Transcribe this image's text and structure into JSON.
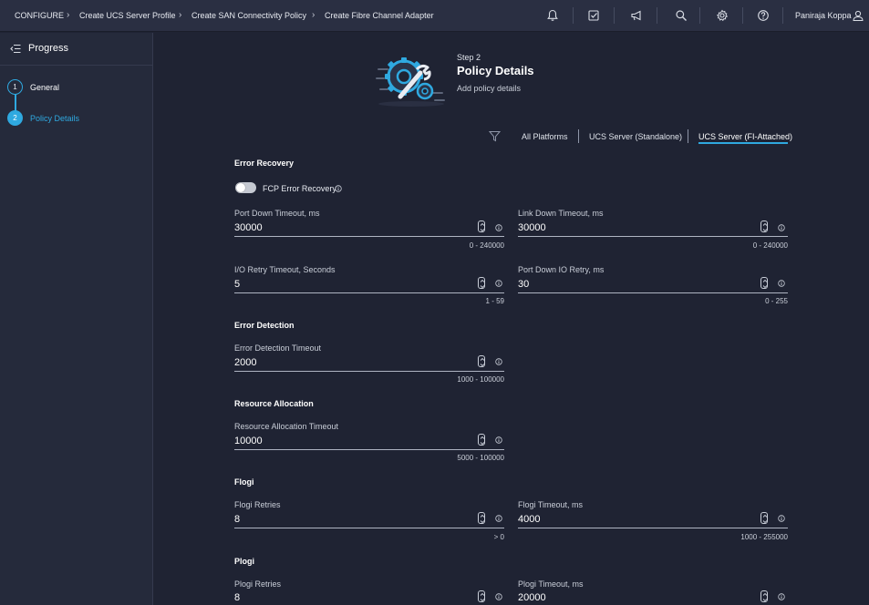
{
  "breadcrumb": {
    "items": [
      "CONFIGURE",
      "Create UCS Server Profile",
      "Create SAN Connectivity Policy",
      "Create Fibre Channel Adapter"
    ]
  },
  "topbar": {
    "icons": [
      "bell-icon",
      "tasks-icon",
      "megaphone-icon",
      "search-icon",
      "gear-icon",
      "help-icon"
    ],
    "user_name": "Paniraja Koppa"
  },
  "sidebar": {
    "title": "Progress",
    "steps": [
      {
        "number": "1",
        "label": "General",
        "active": false
      },
      {
        "number": "2",
        "label": "Policy Details",
        "active": true
      }
    ]
  },
  "header": {
    "step": "Step 2",
    "title": "Policy Details",
    "subtitle": "Add policy details"
  },
  "platform_tabs": {
    "items": [
      "All Platforms",
      "UCS Server (Standalone)",
      "UCS Server (FI-Attached)"
    ],
    "selected": "UCS Server (FI-Attached)"
  },
  "form": {
    "error_recovery": {
      "title": "Error Recovery",
      "fcp_toggle_label": "FCP Error Recovery",
      "fcp_toggle_on": false,
      "port_down_timeout": {
        "label": "Port Down Timeout, ms",
        "value": "30000",
        "range": "0 - 240000"
      },
      "link_down_timeout": {
        "label": "Link Down Timeout, ms",
        "value": "30000",
        "range": "0 - 240000"
      },
      "io_retry_timeout": {
        "label": "I/O Retry Timeout, Seconds",
        "value": "5",
        "range": "1 - 59"
      },
      "port_down_io_retry": {
        "label": "Port Down IO Retry, ms",
        "value": "30",
        "range": "0 - 255"
      }
    },
    "error_detection": {
      "title": "Error Detection",
      "timeout": {
        "label": "Error Detection Timeout",
        "value": "2000",
        "range": "1000 - 100000"
      }
    },
    "resource_allocation": {
      "title": "Resource Allocation",
      "timeout": {
        "label": "Resource Allocation Timeout",
        "value": "10000",
        "range": "5000 - 100000"
      }
    },
    "flogi": {
      "title": "Flogi",
      "retries": {
        "label": "Flogi Retries",
        "value": "8",
        "range": "> 0"
      },
      "timeout": {
        "label": "Flogi Timeout, ms",
        "value": "4000",
        "range": "1000 - 255000"
      }
    },
    "plogi": {
      "title": "Plogi",
      "retries": {
        "label": "Plogi Retries",
        "value": "8"
      },
      "timeout": {
        "label": "Plogi Timeout, ms",
        "value": "20000"
      }
    }
  },
  "colors": {
    "background": "#1f2333",
    "topbar": "#2a2f42",
    "sidebar": "#252a3b",
    "accent": "#2fa9e0"
  }
}
